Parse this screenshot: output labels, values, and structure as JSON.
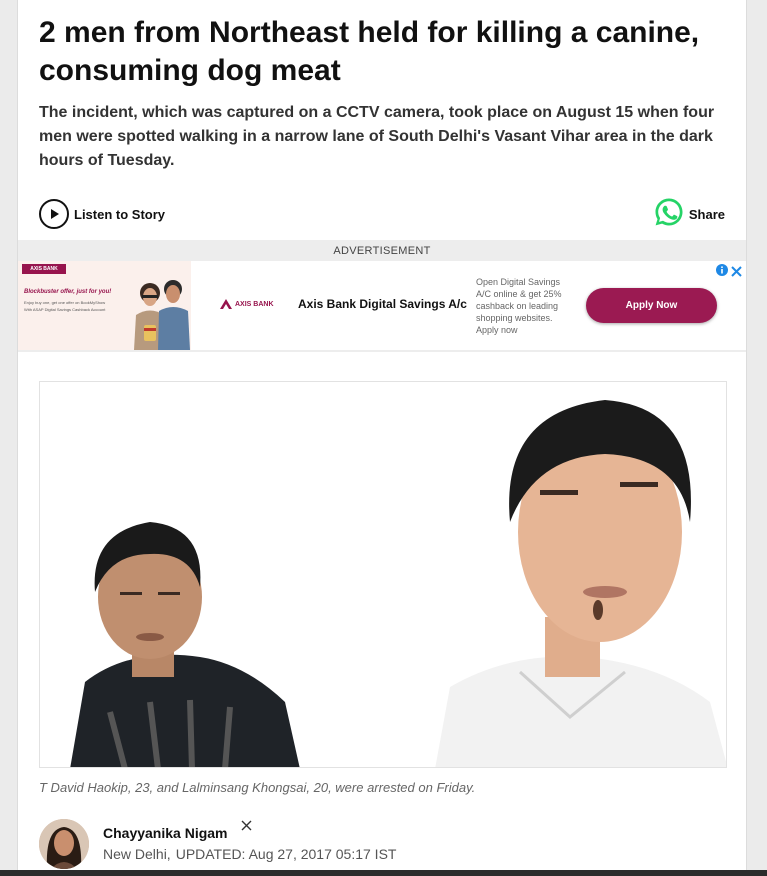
{
  "article": {
    "headline": "2 men from Northeast held for killing a canine, consuming dog meat",
    "summary": "The incident, which was captured on a CCTV camera, took place on August 15 when four men were spotted walking in a narrow lane of South Delhi's Vasant Vihar area in the dark hours of Tuesday.",
    "listen_label": "Listen to Story",
    "share_label": "Share",
    "caption": "T David Haokip, 23, and Lalminsang Khongsai, 20, were arrested on Friday."
  },
  "ad": {
    "label": "ADVERTISEMENT",
    "image_logo": "AXIS BANK",
    "image_offer": "Blockbuster offer, just for you!",
    "image_line1": "Enjoy buy one, get one offer on BookMyShow",
    "image_line2": "With ASAP Digital Savings Cashback Account",
    "brand_logo": "AXIS BANK",
    "title": "Axis Bank Digital Savings A/c",
    "description": "Open Digital Savings A/C online & get 25% cashback on leading shopping websites. Apply now",
    "cta": "Apply Now",
    "brand_color": "#97144d"
  },
  "author": {
    "name": "Chayyanika Nigam",
    "location": "New Delhi,",
    "updated": "UPDATED: Aug 27, 2017 05:17 IST"
  },
  "icons": {
    "listen": "play-icon",
    "share": "whatsapp-icon",
    "author_social": "x-icon",
    "ad_info": "info-icon",
    "ad_close": "close-icon"
  },
  "colors": {
    "whatsapp": "#25d366",
    "ad_cta": "#9b1a52",
    "ad_controls": "#1e88e5"
  }
}
